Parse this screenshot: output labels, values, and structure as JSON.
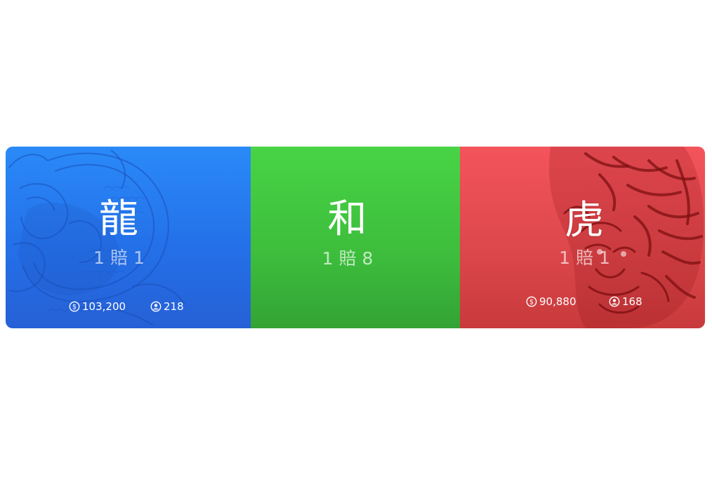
{
  "bets": {
    "dragon": {
      "title": "龍",
      "odds": "1 賠 1",
      "amount": "103,200",
      "players": "218",
      "color": "#2a7ef2"
    },
    "tie": {
      "title": "和",
      "odds": "1 賠 8",
      "color": "#40c340"
    },
    "tiger": {
      "title": "虎",
      "odds": "1 賠 1",
      "amount": "90,880",
      "players": "168",
      "color": "#e24c50"
    }
  },
  "icons": {
    "amount": "dollar-coin-icon",
    "players": "user-circle-icon"
  },
  "artwork": {
    "dragon": "dragon-illustration",
    "tiger": "tiger-illustration"
  }
}
